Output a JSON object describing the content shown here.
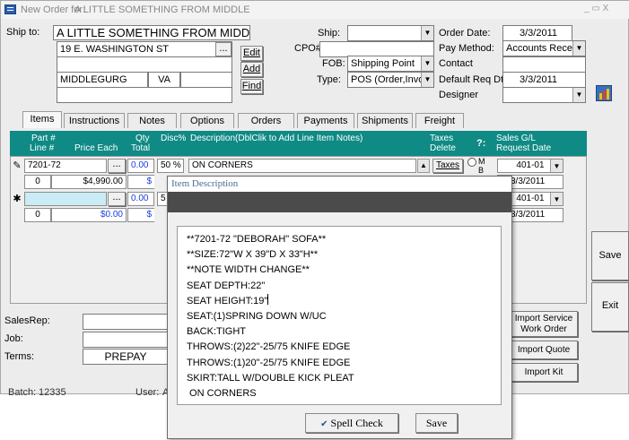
{
  "window": {
    "title_prefix": "New Order for:",
    "title_name": "A LITTLE SOMETHING FROM MIDDLE",
    "controls": "_ ▭ X"
  },
  "shipto": {
    "label": "Ship to:",
    "name": "A LITTLE SOMETHING FROM MIDDLE",
    "address1": "19 E. WASHINGTON ST",
    "address2": "",
    "city": "MIDDLEGURG",
    "state": "VA",
    "zip": "",
    "address4": "",
    "browse_label": "...",
    "edit_label": "Edit",
    "add_label": "Add",
    "find_label": "Find"
  },
  "shipping": {
    "ship_label": "Ship:",
    "ship_value": "",
    "cpo_label": "CPO#:",
    "cpo_value": "",
    "fob_label": "FOB:",
    "fob_value": "Shipping Point",
    "type_label": "Type:",
    "type_value": "POS (Order,Invoic"
  },
  "order": {
    "order_date_label": "Order Date:",
    "order_date": "3/3/2011",
    "pay_method_label": "Pay Method:",
    "pay_method": "Accounts Receiva",
    "contact_label": "Contact",
    "contact": "",
    "default_req_label": "Default Req Dt",
    "default_req": "3/3/2011",
    "designer_label": "Designer",
    "designer": ""
  },
  "tabs": [
    "Items",
    "Instructions",
    "Notes",
    "Options",
    "Orders",
    "Payments",
    "Shipments",
    "Freight"
  ],
  "grid_header": {
    "part": "Part #",
    "line": "Line #",
    "price": "Price Each",
    "qty": "Qty",
    "total": "Total",
    "disc": "Disc%",
    "desc": "Description(DblClik to Add Line Item Notes)",
    "taxes": "Taxes",
    "delete": "Delete",
    "help": "?:",
    "glacct": "Sales G/L",
    "reqdate": "Request Date"
  },
  "rows": [
    {
      "selector": "✎",
      "part": "7201-72",
      "qty": "0.00",
      "disc": "50 %",
      "desc": "ON CORNERS",
      "taxes_btn": "Taxes",
      "radio1": "M",
      "radio2": "B",
      "line": "0",
      "price": "$4,990.00",
      "total": "$",
      "gl": "401-01",
      "req": "3/3/2011"
    },
    {
      "selector": "✱",
      "part": "",
      "qty": "0.00",
      "disc": "5",
      "desc": "",
      "line": "0",
      "price": "$0.00",
      "total": "$",
      "gl": "401-01",
      "req": "3/3/2011"
    }
  ],
  "footer": {
    "salesrep_label": "SalesRep:",
    "job_label": "Job:",
    "terms_label": "Terms:",
    "terms_value": "PREPAY",
    "batch_label": "Batch:",
    "batch_value": "12335",
    "user_label": "User:",
    "user_value": "A"
  },
  "side_buttons": {
    "save": "Save",
    "exit": "Exit",
    "import_service_1": "Import Service",
    "import_service_2": "Work Order",
    "import_quote": "Import Quote",
    "import_kit": "Import Kit"
  },
  "dialog": {
    "title": "Item Description",
    "lines": [
      "**7201-72 \"DEBORAH\" SOFA**",
      "**SIZE:72\"W X 39\"D X 33\"H**",
      "**NOTE WIDTH CHANGE**",
      "SEAT DEPTH:22\"",
      "SEAT HEIGHT:19\"",
      "SEAT:(1)SPRING DOWN W/UC",
      "BACK:TIGHT",
      "THROWS:(2)22\"-25/75 KNIFE EDGE",
      "THROWS:(1)20\"-25/75 KNIFE EDGE",
      "SKIRT:TALL W/DOUBLE KICK PLEAT",
      " ON CORNERS"
    ],
    "spell_check": "Spell Check",
    "save": "Save"
  }
}
